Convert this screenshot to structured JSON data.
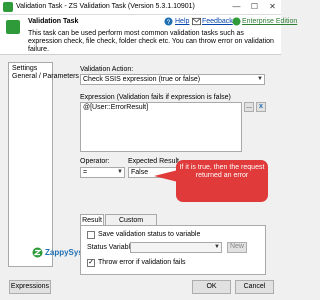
{
  "window": {
    "title": "Validation Task - ZS Validation Task (Version 5.3.1.10901)",
    "minimize_glyph": "—",
    "maximize_glyph": "☐",
    "close_glyph": "✕"
  },
  "header": {
    "title": "Validation Task",
    "description": "This task can be used perform most common validation tasks such as expression check, file check, folder check etc. You can throw error on validation failure.",
    "help_label": "Help",
    "feedback_label": "Feedback",
    "edition_label": "Enterprise Edition"
  },
  "sidebar": {
    "items": [
      {
        "label": "Settings"
      },
      {
        "label": "General / Parameters"
      }
    ],
    "logo_text": "ZappySys"
  },
  "form": {
    "validation_action_label": "Validation Action:",
    "validation_action_value": "Check SSIS expression (true or false)",
    "expression_label": "Expression (Validation fails if expression is false)",
    "expression_value": "@[User::ErrorResult]",
    "expression_browse_label": "...",
    "expression_button_label": "x",
    "operator_label": "Operator:",
    "operator_value": "=",
    "expected_result_label": "Expected Result",
    "expected_result_value": "False"
  },
  "callout": {
    "text": "If it is true, then the request returned an error"
  },
  "tabs": [
    {
      "label": "Result",
      "active": true
    },
    {
      "label": "Custom Message",
      "active": false
    }
  ],
  "result_tab": {
    "save_status_label": "Save validation status to variable",
    "save_status_checked": false,
    "status_variable_label": "Status Variable",
    "status_variable_value": "",
    "new_button_label": "New",
    "throw_error_label": "Throw error if validation fails",
    "throw_error_checked": true,
    "check_glyph": "✓"
  },
  "footer": {
    "expressions_label": "Expressions",
    "ok_label": "OK",
    "cancel_label": "Cancel"
  },
  "colors": {
    "accent_green": "#2e9a3a",
    "callout_red": "#e03a3a",
    "link_blue": "#0645ad"
  }
}
